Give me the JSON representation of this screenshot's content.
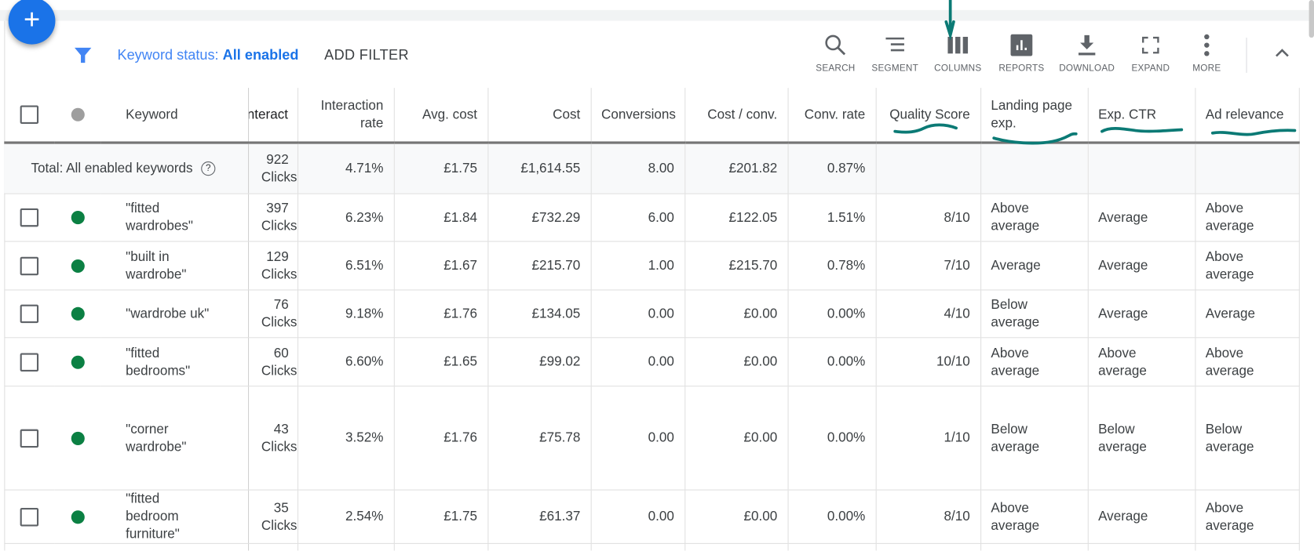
{
  "toolbar": {
    "fab_label": "+",
    "filter_label": "Keyword status:",
    "filter_value": "All enabled",
    "add_filter": "ADD FILTER",
    "tools": [
      {
        "label": "SEARCH",
        "icon": "search-icon"
      },
      {
        "label": "SEGMENT",
        "icon": "segment-icon"
      },
      {
        "label": "COLUMNS",
        "icon": "columns-icon"
      },
      {
        "label": "REPORTS",
        "icon": "reports-icon"
      },
      {
        "label": "DOWNLOAD",
        "icon": "download-icon"
      },
      {
        "label": "EXPAND",
        "icon": "expand-icon"
      },
      {
        "label": "MORE",
        "icon": "more-icon"
      }
    ]
  },
  "table": {
    "headers": {
      "keyword": "Keyword",
      "interactions": "Interact",
      "interaction_rate": "Interaction rate",
      "avg_cost": "Avg. cost",
      "cost": "Cost",
      "conversions": "Conversions",
      "cost_conv": "Cost / conv.",
      "conv_rate": "Conv. rate",
      "quality_score": "Quality Score",
      "landing_page": "Landing page exp.",
      "exp_ctr": "Exp. CTR",
      "ad_relevance": "Ad relevance"
    },
    "total": {
      "label": "Total: All enabled keywords",
      "help": "?",
      "interactions": "922",
      "interactions_unit": "Clicks",
      "interaction_rate": "4.71%",
      "avg_cost": "£1.75",
      "cost": "£1,614.55",
      "conversions": "8.00",
      "cost_conv": "£201.82",
      "conv_rate": "0.87%"
    },
    "rows": [
      {
        "keyword": "\"fitted wardrobes\"",
        "interactions": "397",
        "unit": "Clicks",
        "interaction_rate": "6.23%",
        "avg_cost": "£1.84",
        "cost": "£732.29",
        "conversions": "6.00",
        "cost_conv": "£122.05",
        "conv_rate": "1.51%",
        "quality_score": "8/10",
        "landing_page": "Above average",
        "exp_ctr": "Average",
        "ad_relevance": "Above average"
      },
      {
        "keyword": "\"built in wardrobe\"",
        "interactions": "129",
        "unit": "Clicks",
        "interaction_rate": "6.51%",
        "avg_cost": "£1.67",
        "cost": "£215.70",
        "conversions": "1.00",
        "cost_conv": "£215.70",
        "conv_rate": "0.78%",
        "quality_score": "7/10",
        "landing_page": "Average",
        "exp_ctr": "Average",
        "ad_relevance": "Above average"
      },
      {
        "keyword": "\"wardrobe uk\"",
        "interactions": "76",
        "unit": "Clicks",
        "interaction_rate": "9.18%",
        "avg_cost": "£1.76",
        "cost": "£134.05",
        "conversions": "0.00",
        "cost_conv": "£0.00",
        "conv_rate": "0.00%",
        "quality_score": "4/10",
        "landing_page": "Below average",
        "exp_ctr": "Average",
        "ad_relevance": "Average"
      },
      {
        "keyword": "\"fitted bedrooms\"",
        "interactions": "60",
        "unit": "Clicks",
        "interaction_rate": "6.60%",
        "avg_cost": "£1.65",
        "cost": "£99.02",
        "conversions": "0.00",
        "cost_conv": "£0.00",
        "conv_rate": "0.00%",
        "quality_score": "10/10",
        "landing_page": "Above average",
        "exp_ctr": "Above average",
        "ad_relevance": "Above average"
      },
      {
        "keyword": "\"corner wardrobe\"",
        "interactions": "43",
        "unit": "Clicks",
        "interaction_rate": "3.52%",
        "avg_cost": "£1.76",
        "cost": "£75.78",
        "conversions": "0.00",
        "cost_conv": "£0.00",
        "conv_rate": "0.00%",
        "quality_score": "1/10",
        "landing_page": "Below average",
        "exp_ctr": "Below average",
        "ad_relevance": "Below average"
      },
      {
        "keyword": "\"fitted bedroom furniture\"",
        "interactions": "35",
        "unit": "Clicks",
        "interaction_rate": "2.54%",
        "avg_cost": "£1.75",
        "cost": "£61.37",
        "conversions": "0.00",
        "cost_conv": "£0.00",
        "conv_rate": "0.00%",
        "quality_score": "8/10",
        "landing_page": "Above average",
        "exp_ctr": "Average",
        "ad_relevance": "Above average"
      }
    ]
  },
  "colors": {
    "accent": "#1a73e8",
    "status_enabled": "#0b8043",
    "status_header": "#9e9e9e",
    "annotation": "#0b7a75"
  }
}
